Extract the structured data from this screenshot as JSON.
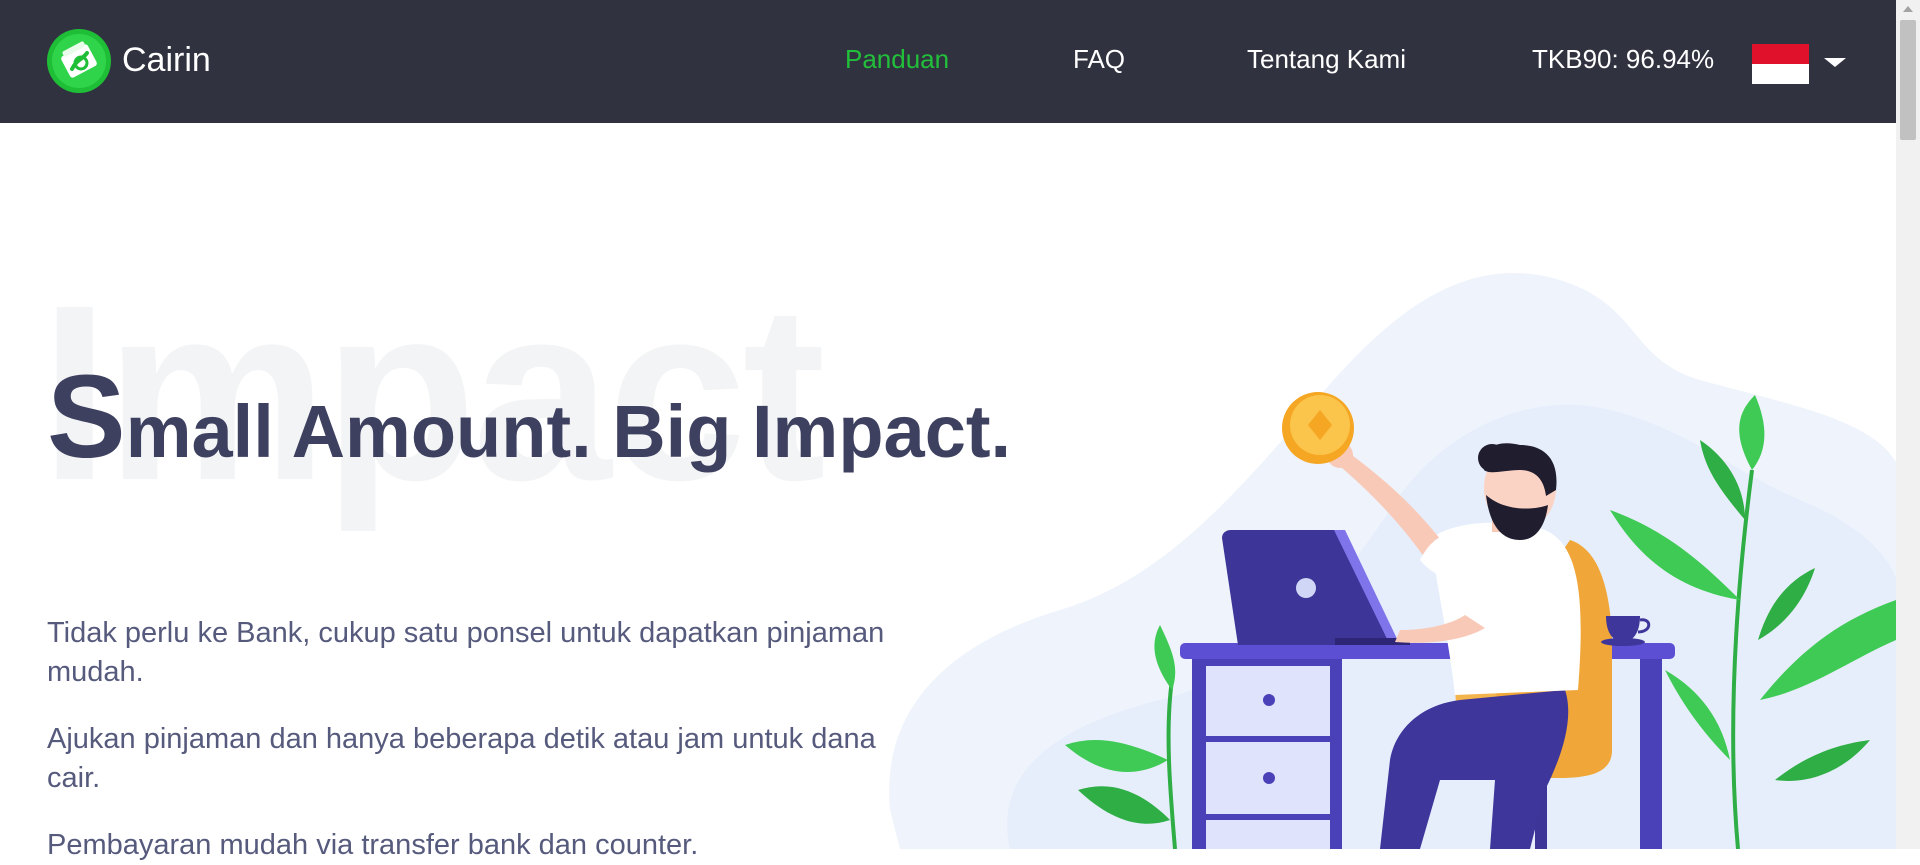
{
  "header": {
    "brand": "Cairin",
    "nav": [
      {
        "label": "Panduan"
      },
      {
        "label": "FAQ"
      },
      {
        "label": "Tentang Kami"
      }
    ],
    "stat": "TKB90: 96.94%",
    "language_icon": "indonesia-flag-icon",
    "colors": {
      "background": "#30323f",
      "active": "#22c03a",
      "text": "#ffffff"
    }
  },
  "hero": {
    "background_word": "Impact",
    "headline_initial": "S",
    "headline_rest": "mall Amount. Big Impact.",
    "paragraphs": [
      "Tidak perlu ke Bank, cukup satu ponsel untuk dapatkan pinjaman mudah.",
      "Ajukan pinjaman dan hanya beberapa detik atau jam untuk dana cair.",
      "Pembayaran mudah via transfer bank dan counter."
    ],
    "colors": {
      "headline": "#3e4060",
      "body": "#565a7c"
    }
  }
}
